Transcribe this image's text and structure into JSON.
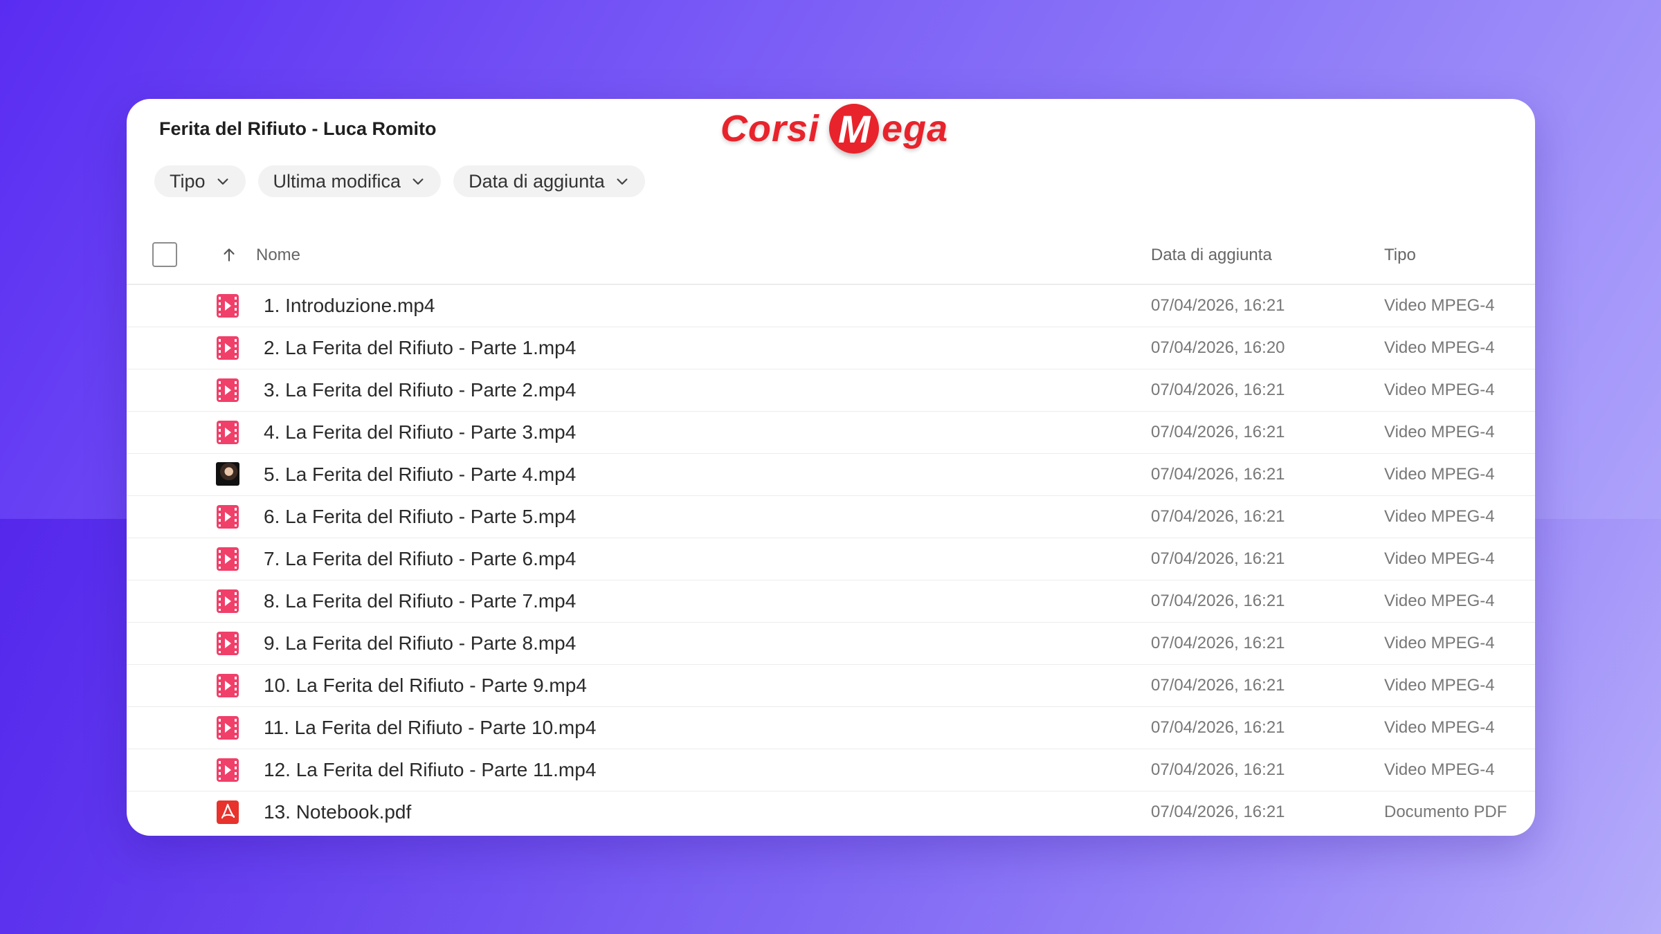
{
  "window": {
    "title": "Ferita del Rifiuto - Luca Romito",
    "brand": {
      "prefix": "Corsi",
      "m": "M",
      "suffix": "ega",
      "color": "#e8232b"
    }
  },
  "filters": [
    {
      "label": "Tipo"
    },
    {
      "label": "Ultima modifica"
    },
    {
      "label": "Data di aggiunta"
    }
  ],
  "table": {
    "columns": {
      "name": "Nome",
      "date": "Data di aggiunta",
      "type": "Tipo"
    },
    "rows": [
      {
        "name": "1. Introduzione.mp4",
        "date": "07/04/2026, 16:21",
        "type": "Video MPEG-4",
        "icon": "video-file-icon"
      },
      {
        "name": "2. La Ferita del Rifiuto - Parte 1.mp4",
        "date": "07/04/2026, 16:20",
        "type": "Video MPEG-4",
        "icon": "video-file-icon"
      },
      {
        "name": "3. La Ferita del Rifiuto - Parte 2.mp4",
        "date": "07/04/2026, 16:21",
        "type": "Video MPEG-4",
        "icon": "video-file-icon"
      },
      {
        "name": "4. La Ferita del Rifiuto - Parte 3.mp4",
        "date": "07/04/2026, 16:21",
        "type": "Video MPEG-4",
        "icon": "video-file-icon"
      },
      {
        "name": "5. La Ferita del Rifiuto - Parte 4.mp4",
        "date": "07/04/2026, 16:21",
        "type": "Video MPEG-4",
        "icon": "video-thumbnail"
      },
      {
        "name": "6. La Ferita del Rifiuto - Parte 5.mp4",
        "date": "07/04/2026, 16:21",
        "type": "Video MPEG-4",
        "icon": "video-file-icon"
      },
      {
        "name": "7. La Ferita del Rifiuto - Parte 6.mp4",
        "date": "07/04/2026, 16:21",
        "type": "Video MPEG-4",
        "icon": "video-file-icon"
      },
      {
        "name": "8. La Ferita del Rifiuto - Parte 7.mp4",
        "date": "07/04/2026, 16:21",
        "type": "Video MPEG-4",
        "icon": "video-file-icon"
      },
      {
        "name": "9. La Ferita del Rifiuto - Parte 8.mp4",
        "date": "07/04/2026, 16:21",
        "type": "Video MPEG-4",
        "icon": "video-file-icon"
      },
      {
        "name": "10. La Ferita del Rifiuto - Parte 9.mp4",
        "date": "07/04/2026, 16:21",
        "type": "Video MPEG-4",
        "icon": "video-file-icon"
      },
      {
        "name": "11. La Ferita del Rifiuto - Parte 10.mp4",
        "date": "07/04/2026, 16:21",
        "type": "Video MPEG-4",
        "icon": "video-file-icon"
      },
      {
        "name": "12. La Ferita del Rifiuto - Parte 11.mp4",
        "date": "07/04/2026, 16:21",
        "type": "Video MPEG-4",
        "icon": "video-file-icon"
      },
      {
        "name": "13. Notebook.pdf",
        "date": "07/04/2026, 16:21",
        "type": "Documento PDF",
        "icon": "pdf-file-icon"
      }
    ]
  },
  "colors": {
    "video_icon": "#f0406a",
    "pdf_icon": "#e8322c"
  }
}
